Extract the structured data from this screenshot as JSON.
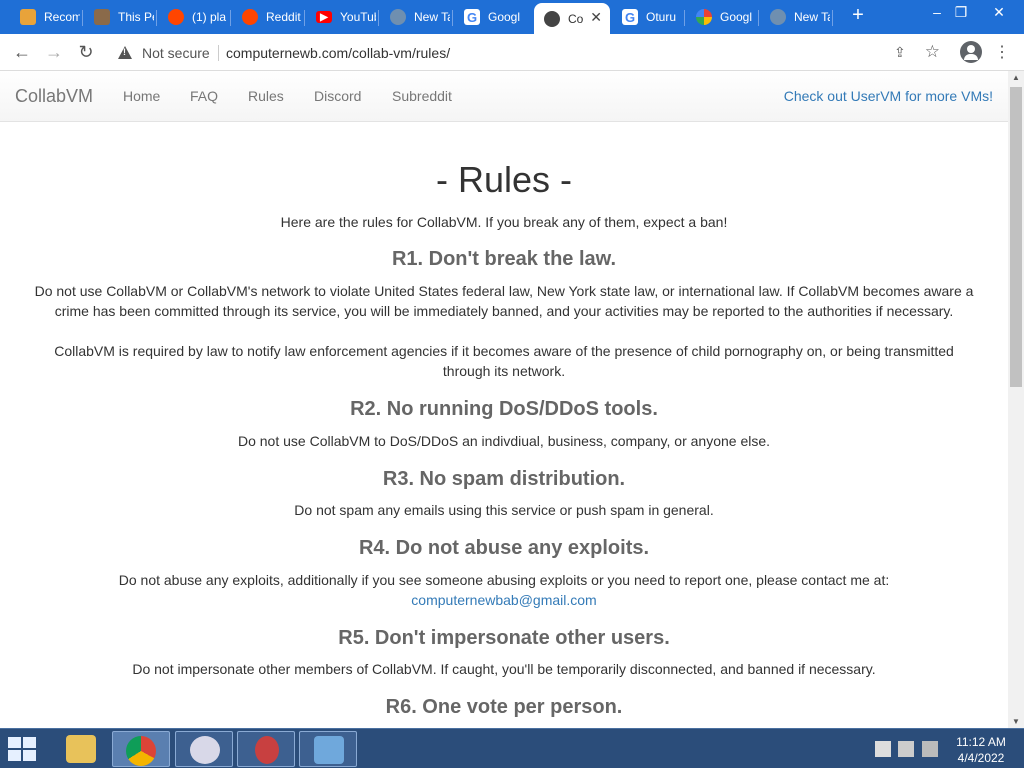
{
  "tabs": [
    {
      "title": "Recom",
      "icon": "pinwheel-icon",
      "color": "#e8a33a"
    },
    {
      "title": "This Pe",
      "icon": "person-photo-icon",
      "color": "#8a6a4a"
    },
    {
      "title": "(1) pla",
      "icon": "reddit-icon",
      "color": "#ff4500"
    },
    {
      "title": "Reddit",
      "icon": "reddit-icon",
      "color": "#ff4500"
    },
    {
      "title": "YouTub",
      "icon": "youtube-icon",
      "color": "#ff0000"
    },
    {
      "title": "New Ta",
      "icon": "globe-icon",
      "color": "#6f8fb0"
    },
    {
      "title": "Googl",
      "icon": "google-icon",
      "color": "#4285f4"
    },
    {
      "title": "Co",
      "icon": "collabvm-icon",
      "color": "#444444"
    },
    {
      "title": "Oturu",
      "icon": "google-icon",
      "color": "#4285f4"
    },
    {
      "title": "Googl",
      "icon": "photos-icon",
      "color": "#fbbc05"
    },
    {
      "title": "New Ta",
      "icon": "globe-icon",
      "color": "#6f8fb0"
    }
  ],
  "omnibox": {
    "security_label": "Not secure",
    "url": "computernewb.com/collab-vm/rules/"
  },
  "site_nav": {
    "brand": "CollabVM",
    "links": [
      "Home",
      "FAQ",
      "Rules",
      "Discord",
      "Subreddit"
    ],
    "right_link": "Check out UserVM for more VMs!"
  },
  "content": {
    "title": "- Rules -",
    "intro": "Here are the rules for CollabVM. If you break any of them, expect a ban!",
    "rules": [
      {
        "heading": "R1. Don't break the law.",
        "paragraphs": [
          "Do not use CollabVM or CollabVM's network to violate United States federal law, New York state law, or international law. If CollabVM becomes aware a crime has been committed through its service, you will be immediately banned, and your activities may be reported to the authorities if necessary.",
          "CollabVM is required by law to notify law enforcement agencies if it becomes aware of the presence of child pornography on, or being transmitted through its network."
        ]
      },
      {
        "heading": "R2. No running DoS/DDoS tools.",
        "paragraphs": [
          "Do not use CollabVM to DoS/DDoS an indivdiual, business, company, or anyone else."
        ]
      },
      {
        "heading": "R3. No spam distribution.",
        "paragraphs": [
          "Do not spam any emails using this service or push spam in general."
        ]
      },
      {
        "heading": "R4. Do not abuse any exploits.",
        "paragraphs": [
          "Do not abuse any exploits, additionally if you see someone abusing exploits or you need to report one, please contact me at:"
        ],
        "email": "computernewbab@gmail.com"
      },
      {
        "heading": "R5. Don't impersonate other users.",
        "paragraphs": [
          "Do not impersonate other members of CollabVM. If caught, you'll be temporarily disconnected, and banned if necessary."
        ]
      },
      {
        "heading": "R6. One vote per person.",
        "paragraphs": []
      }
    ]
  },
  "taskbar": {
    "time": "11:12 AM",
    "date": "4/4/2022"
  }
}
